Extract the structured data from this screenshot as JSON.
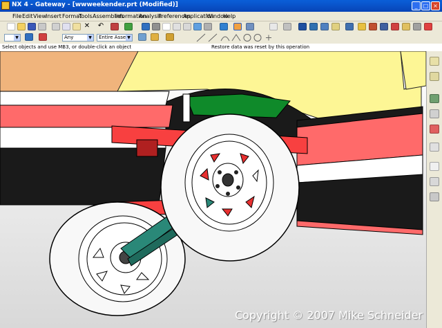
{
  "window": {
    "title": "NX 4 - Gateway - [wwweekender.prt (Modified)]",
    "controls": [
      "_",
      "□",
      "×"
    ]
  },
  "menu": {
    "items": [
      {
        "label": "File",
        "enabled": true
      },
      {
        "label": "Edit",
        "enabled": true
      },
      {
        "label": "View",
        "enabled": true
      },
      {
        "label": "Insert",
        "enabled": true
      },
      {
        "label": "Format",
        "enabled": true
      },
      {
        "label": "Tools",
        "enabled": true
      },
      {
        "label": "Assemblies",
        "enabled": true
      },
      {
        "label": "Information",
        "enabled": true
      },
      {
        "label": "Analysis",
        "enabled": true
      },
      {
        "label": "Preferences",
        "enabled": true
      },
      {
        "label": "Application",
        "enabled": true
      },
      {
        "label": "Window",
        "enabled": true
      },
      {
        "label": "Help",
        "enabled": true
      }
    ]
  },
  "toolbar": {
    "filter_selected": "Any",
    "assembly_scope_selected": "Entire Assembly"
  },
  "cue_line": {
    "left": "Select objects and use MB3, or double-click an object",
    "right": "Restore data was reset by this operation"
  },
  "colors": {
    "body_yellow": "#fdf695",
    "body_orange": "#f0b47c",
    "frame_red": "#ff6a6a",
    "bracket_red": "#f84040",
    "axle_teal": "#2a8878",
    "tire_white": "#f8f8f8"
  },
  "watermark": "Copyright © 2007 Mike Schneider"
}
